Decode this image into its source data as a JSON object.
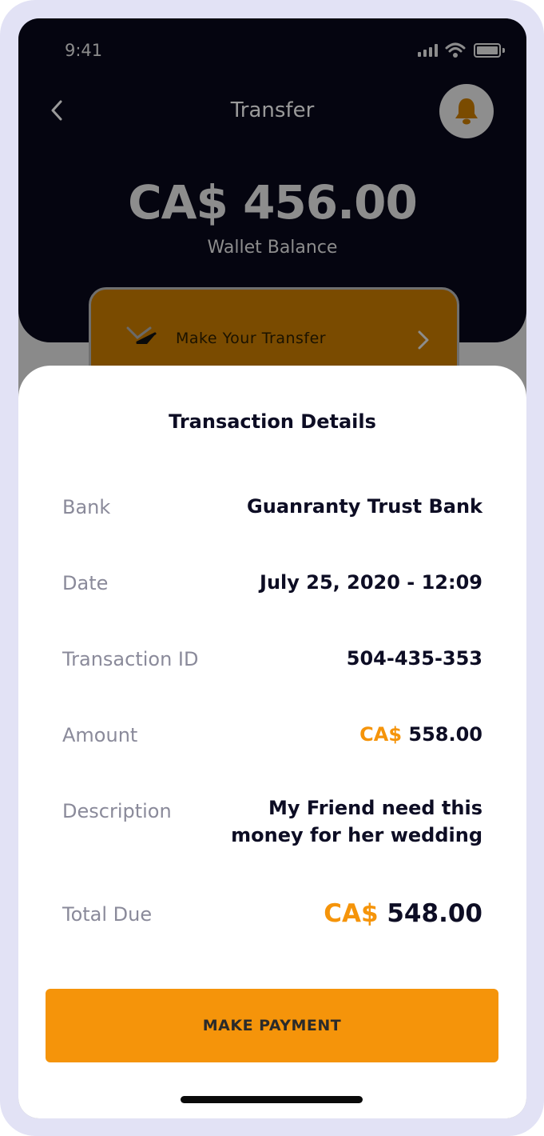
{
  "status_bar": {
    "time": "9:41"
  },
  "header": {
    "title": "Transfer",
    "balance_amount": "CA$ 456.00",
    "balance_label": "Wallet Balance"
  },
  "transfer_card": {
    "label": "Make Your Transfer"
  },
  "sheet": {
    "title": "Transaction Details",
    "rows": {
      "bank": {
        "label": "Bank",
        "value": "Guanranty Trust Bank"
      },
      "date": {
        "label": "Date",
        "value": "July 25, 2020 - 12:09"
      },
      "transaction_id": {
        "label": "Transaction ID",
        "value": "504-435-353"
      },
      "amount": {
        "label": "Amount",
        "currency": "CA$",
        "value": "558.00"
      },
      "description": {
        "label": "Description",
        "value": "My Friend need this money for her wedding"
      },
      "total_due": {
        "label": "Total Due",
        "currency": "CA$",
        "value": "548.00"
      }
    },
    "pay_button_label": "MAKE PAYMENT"
  },
  "colors": {
    "accent": "#f5940a",
    "header_bg": "#050510",
    "frame": "#e2e2f5",
    "card_bg": "#7a4b00"
  },
  "icons": [
    "back-chevron-icon",
    "bell-icon",
    "signal-icon",
    "wifi-icon",
    "battery-icon",
    "send-transfer-icon",
    "chevron-right-icon"
  ]
}
